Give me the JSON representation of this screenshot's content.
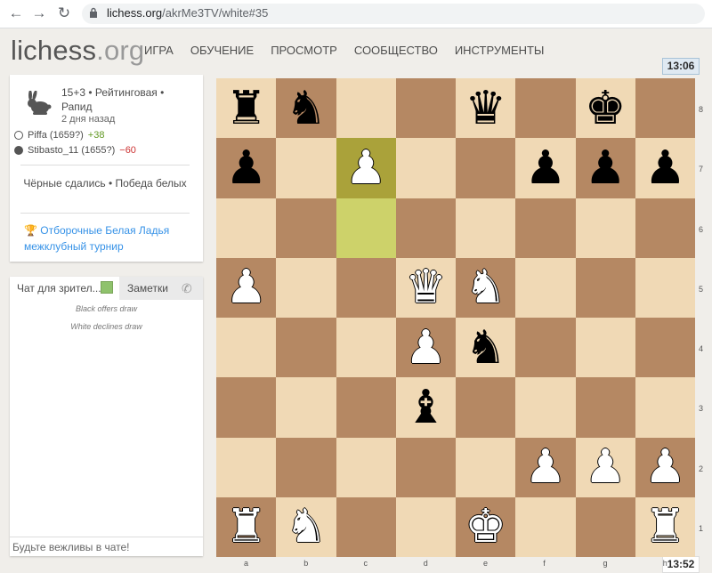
{
  "browser": {
    "url_host": "lichess.org",
    "url_path": "/akrMe3TV/white#35"
  },
  "site": {
    "logo_main": "lichess",
    "logo_tld": ".org",
    "menu": [
      "ИГРА",
      "ОБУЧЕНИЕ",
      "ПРОСМОТР",
      "СООБЩЕСТВО",
      "ИНСТРУМЕНТЫ"
    ]
  },
  "clocks": {
    "top": "13:06",
    "bottom": "13:52"
  },
  "game": {
    "type": "15+3 • Рейтинговая • Рапид",
    "time_ago": "2 дня назад",
    "white_player": "Piffa (1659?)",
    "white_diff": "+38",
    "black_player": "Stibasto_11 (1655?)",
    "black_diff": "−60",
    "result": "Чёрные сдались • Победа белых",
    "tournament": "Отборочные Белая Ладья межклубный турнир"
  },
  "chat": {
    "tab_chat": "Чат для зрител...",
    "tab_notes": "Заметки",
    "messages": [
      "Black offers draw",
      "White declines draw"
    ],
    "input_placeholder": "Будьте вежливы в чате!"
  },
  "board": {
    "ranks": [
      "8",
      "7",
      "6",
      "5",
      "4",
      "3",
      "2",
      "1"
    ],
    "files": [
      "a",
      "b",
      "c",
      "d",
      "e",
      "f",
      "g",
      "h"
    ],
    "position": [
      [
        "bR",
        "bN",
        "",
        "",
        "bQ",
        "",
        "bK",
        ""
      ],
      [
        "bP",
        "",
        "wP",
        "",
        "",
        "bP",
        "bP",
        "bP"
      ],
      [
        "",
        "",
        "",
        "",
        "",
        "",
        "",
        ""
      ],
      [
        "wP",
        "",
        "",
        "wQ",
        "wN",
        "",
        "",
        ""
      ],
      [
        "",
        "",
        "",
        "wP",
        "bN",
        "",
        "",
        ""
      ],
      [
        "",
        "",
        "",
        "bB",
        "",
        "",
        "",
        ""
      ],
      [
        "",
        "",
        "",
        "",
        "",
        "wP",
        "wP",
        "wP"
      ],
      [
        "wR",
        "wN",
        "",
        "",
        "wK",
        "",
        "",
        "wR"
      ]
    ],
    "last_move": [
      "c6",
      "c7"
    ]
  }
}
